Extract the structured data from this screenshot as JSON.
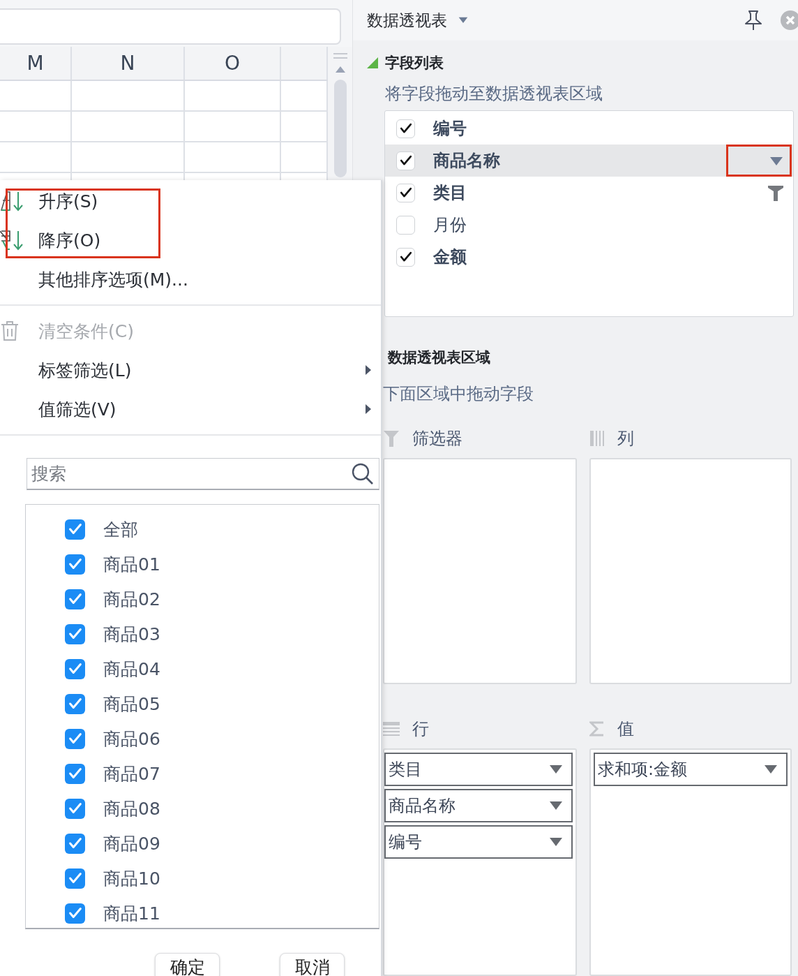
{
  "sheet": {
    "columns": [
      "M",
      "N",
      "O"
    ]
  },
  "menu": {
    "sort_items": [
      {
        "label": "升序(S)",
        "kind": "ascending"
      },
      {
        "label": "降序(O)",
        "kind": "descending"
      }
    ],
    "sort_highlighted": true,
    "more_sort": "其他排序选项(M)...",
    "filter_items": [
      {
        "label": "清空条件(C)",
        "kind": "clear",
        "disabled": true
      },
      {
        "label": "标签筛选(L)",
        "kind": "submenu",
        "disabled": false
      },
      {
        "label": "值筛选(V)",
        "kind": "submenu",
        "disabled": false
      }
    ],
    "search": {
      "placeholder": "搜索"
    },
    "values": [
      {
        "label": "全部",
        "checked": true
      },
      {
        "label": "商品01",
        "checked": true
      },
      {
        "label": "商品02",
        "checked": true
      },
      {
        "label": "商品03",
        "checked": true
      },
      {
        "label": "商品04",
        "checked": true
      },
      {
        "label": "商品05",
        "checked": true
      },
      {
        "label": "商品06",
        "checked": true
      },
      {
        "label": "商品07",
        "checked": true
      },
      {
        "label": "商品08",
        "checked": true
      },
      {
        "label": "商品09",
        "checked": true
      },
      {
        "label": "商品10",
        "checked": true
      },
      {
        "label": "商品11",
        "checked": true
      }
    ],
    "buttons": [
      "确定",
      "取消"
    ]
  },
  "pivot": {
    "title": "数据透视表",
    "field_section": {
      "title": "字段列表",
      "expanded": true,
      "hint": "将字段拖动至数据透视表区域",
      "fields": [
        {
          "name": "编号",
          "checked": true,
          "selected": false,
          "filtered": false,
          "highlighted": false
        },
        {
          "name": "商品名称",
          "checked": true,
          "selected": true,
          "filtered": false,
          "highlighted": true
        },
        {
          "name": "类目",
          "checked": true,
          "selected": false,
          "filtered": true,
          "highlighted": false
        },
        {
          "name": "月份",
          "checked": false,
          "selected": false,
          "filtered": false,
          "highlighted": false
        },
        {
          "name": "金额",
          "checked": true,
          "selected": false,
          "filtered": false,
          "highlighted": false
        }
      ]
    },
    "area_section": {
      "title": "数据透视表区域",
      "hint": "下面区域中拖动字段",
      "areas": [
        {
          "kind": "filter",
          "label": "筛选器"
        },
        {
          "kind": "columns",
          "label": "列"
        },
        {
          "kind": "rows",
          "label": "行",
          "items": [
            "类目",
            "商品名称",
            "编号"
          ]
        },
        {
          "kind": "values",
          "label": "值",
          "items": [
            "求和项:金额"
          ]
        }
      ]
    }
  }
}
